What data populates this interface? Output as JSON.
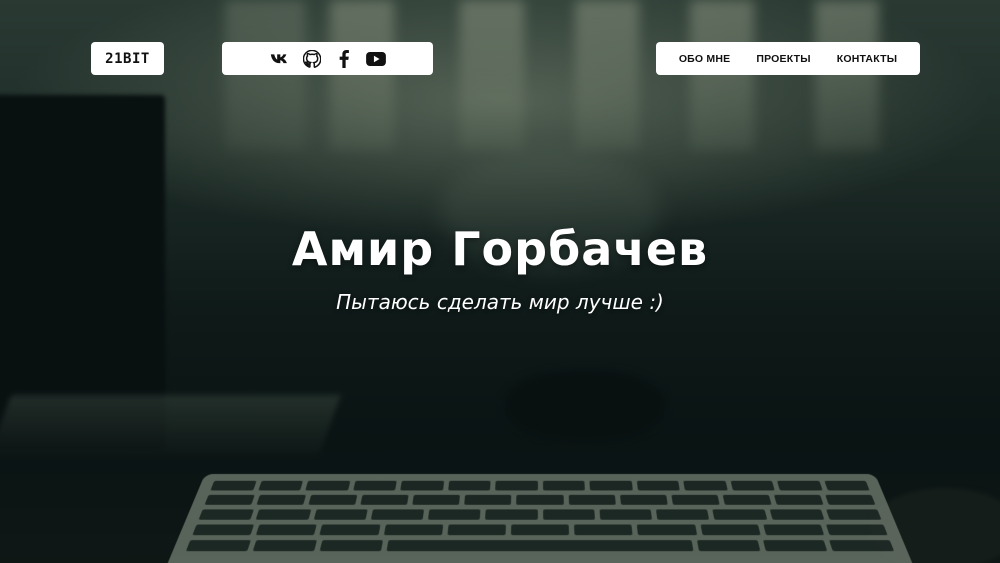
{
  "brand": {
    "logo_label": "21BIT"
  },
  "social": {
    "icons": [
      {
        "name": "vk-icon",
        "label": "VK"
      },
      {
        "name": "github-icon",
        "label": "GitHub"
      },
      {
        "name": "facebook-icon",
        "label": "Facebook"
      },
      {
        "name": "youtube-icon",
        "label": "YouTube"
      }
    ]
  },
  "nav": {
    "items": [
      {
        "label": "ОБО МНЕ"
      },
      {
        "label": "ПРОЕКТЫ"
      },
      {
        "label": "КОНТАКТЫ"
      }
    ]
  },
  "hero": {
    "title": "Амир Горбачев",
    "subtitle": "Пытаюсь сделать мир лучше :)"
  },
  "colors": {
    "pill_background": "#ffffff",
    "text_dark": "#111111",
    "hero_text": "#ffffff",
    "background_dark": "#0d1716"
  }
}
